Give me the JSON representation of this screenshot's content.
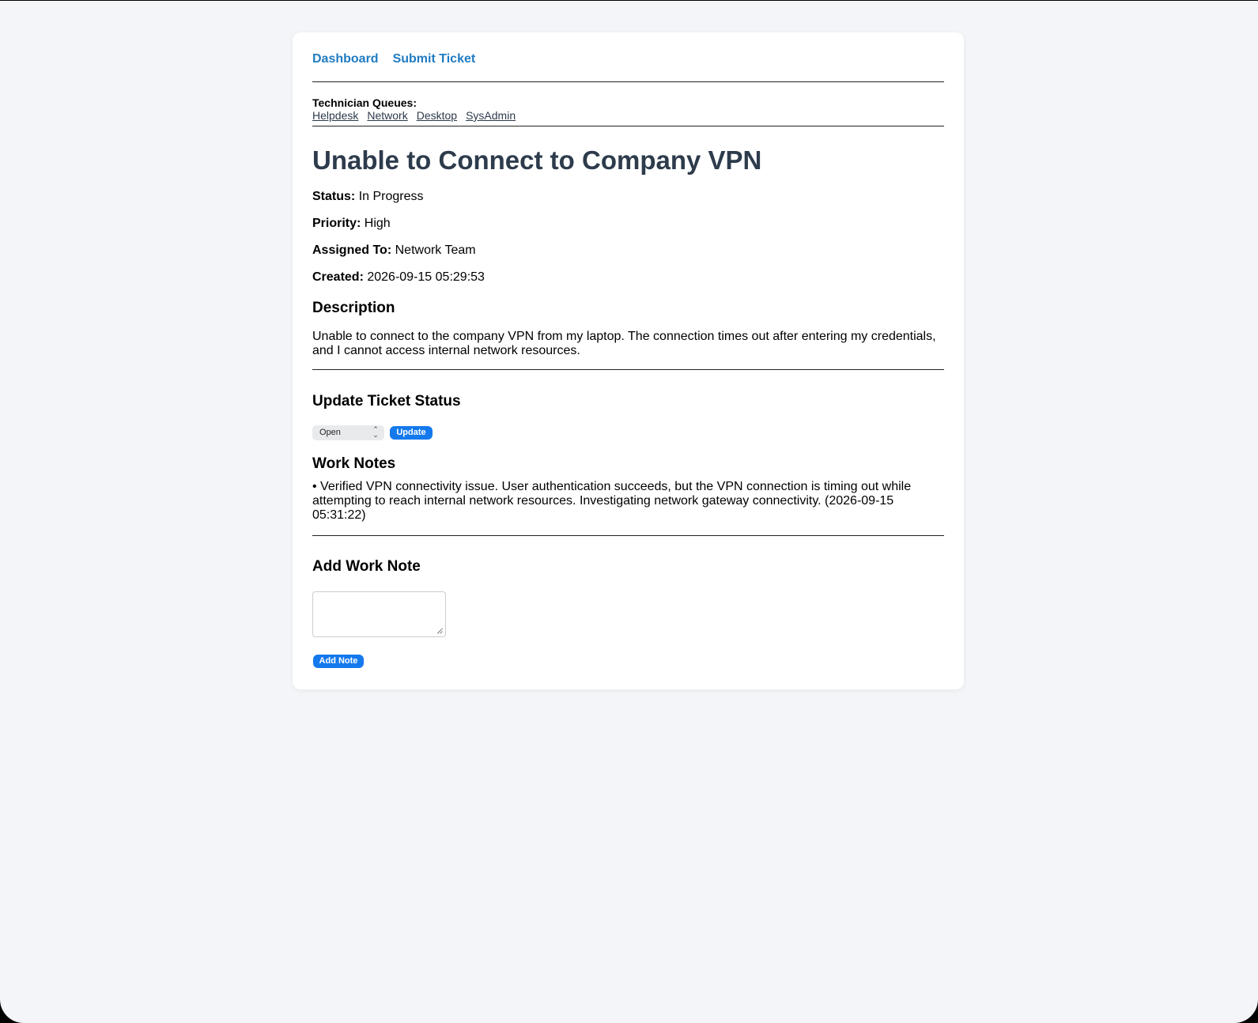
{
  "nav": {
    "dashboard": "Dashboard",
    "submit_ticket": "Submit Ticket"
  },
  "queues": {
    "label": "Technician Queues:",
    "items": [
      "Helpdesk",
      "Network",
      "Desktop",
      "SysAdmin"
    ]
  },
  "ticket": {
    "title": "Unable to Connect to Company VPN",
    "status_label": "Status:",
    "status_value": "In Progress",
    "priority_label": "Priority:",
    "priority_value": "High",
    "assigned_label": "Assigned To:",
    "assigned_value": "Network Team",
    "created_label": "Created:",
    "created_value": "2026-09-15 05:29:53",
    "description_heading": "Description",
    "description": "Unable to connect to the company VPN from my laptop. The connection times out after entering my credentials, and I cannot access internal network resources."
  },
  "update_status": {
    "heading": "Update Ticket Status",
    "selected": "Open",
    "button": "Update"
  },
  "work_notes": {
    "heading": "Work Notes",
    "notes": [
      "• Verified VPN connectivity issue. User authentication succeeds, but the VPN connection is timing out while attempting to reach internal network resources. Investigating network gateway connectivity. (2026-09-15 05:31:22)"
    ]
  },
  "add_note": {
    "heading": "Add Work Note",
    "textarea_value": "",
    "button": "Add Note"
  },
  "colors": {
    "link": "#1f7bc1",
    "title": "#2d3b4c",
    "button": "#1479ed",
    "page_bg": "#f3f5f8"
  }
}
